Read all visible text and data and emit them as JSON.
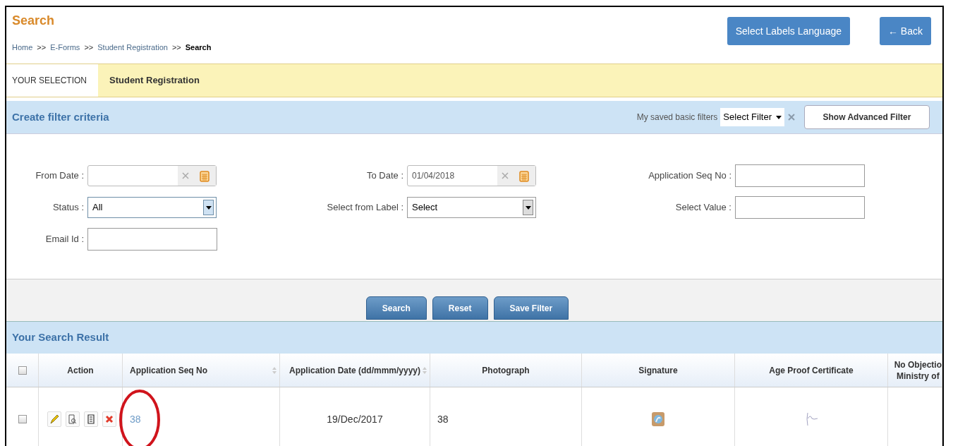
{
  "header": {
    "title": "Search",
    "breadcrumb": [
      {
        "label": "Home",
        "current": false
      },
      {
        "label": "E-Forms",
        "current": false
      },
      {
        "label": "Student Registration",
        "current": false
      },
      {
        "label": "Search",
        "current": true
      }
    ],
    "separator": ">>",
    "buttons": [
      {
        "label": "Select Labels Language"
      },
      {
        "label": "← Back"
      }
    ]
  },
  "selection_bar": {
    "label": "YOUR SELECTION",
    "value": "Student Registration"
  },
  "filter_panel": {
    "title": "Create filter criteria",
    "saved_filters_label": "My saved basic filters",
    "saved_filter_select": "Select Filter",
    "advanced_button": "Show Advanced Filter",
    "rows": [
      [
        {
          "label": "From Date :",
          "kind": "date"
        },
        {
          "label": "To Date :",
          "kind": "date",
          "value": "01/04/2018"
        },
        {
          "label": "Application Seq No :",
          "kind": "text"
        }
      ],
      [
        {
          "label": "Status :",
          "kind": "select",
          "value": "All",
          "focused": true
        },
        {
          "label": "Select from Label :",
          "kind": "select",
          "value": "Select",
          "focused": false
        },
        {
          "label": "Select Value :",
          "kind": "text"
        }
      ],
      [
        {
          "label": "Email Id :",
          "kind": "text"
        }
      ]
    ],
    "actions": [
      "Search",
      "Reset",
      "Save Filter"
    ]
  },
  "results": {
    "title": "Your Search Result",
    "columns": [
      {
        "kind": "checkbox",
        "checked": false
      },
      {
        "kind": "label",
        "lines": [
          "Action"
        ],
        "sortable": false
      },
      {
        "kind": "label",
        "lines": [
          "Application Seq No"
        ],
        "sortable": true
      },
      {
        "kind": "label",
        "lines": [
          "Application Date (dd/mmm/yyyy)"
        ],
        "sortable": true
      },
      {
        "kind": "label",
        "lines": [
          "Photograph"
        ],
        "sortable": false
      },
      {
        "kind": "label",
        "lines": [
          "Signature"
        ],
        "sortable": false
      },
      {
        "kind": "label",
        "lines": [
          "Age Proof Certificate"
        ],
        "sortable": false
      },
      {
        "kind": "label",
        "lines": [
          "No Objectio",
          "Ministry of"
        ],
        "sortable": false
      }
    ],
    "rows": [
      {
        "cells": [
          {
            "kind": "checkbox",
            "checked": false
          },
          {
            "kind": "actions"
          },
          {
            "kind": "link",
            "text": "38",
            "circled": true
          },
          {
            "kind": "date",
            "text": "19/Dec/2017"
          },
          {
            "kind": "text",
            "text": "38"
          },
          {
            "kind": "image"
          },
          {
            "kind": "signature"
          },
          {
            "kind": "empty"
          }
        ]
      }
    ]
  }
}
